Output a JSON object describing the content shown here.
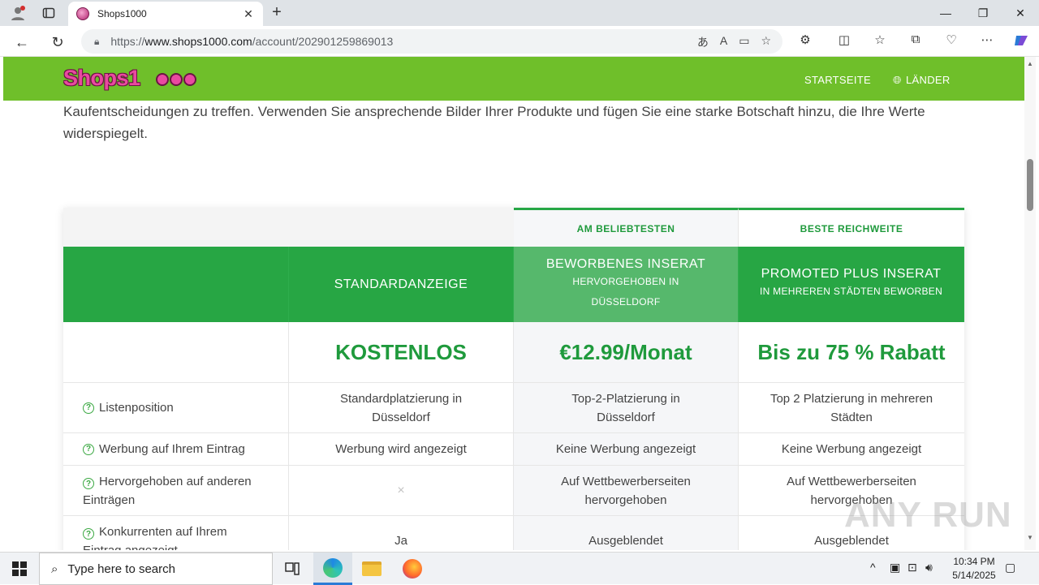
{
  "browser": {
    "tab_title": "Shops1000",
    "url_prefix": "https://",
    "url_host": "www.shops1000.com",
    "url_path": "/account/202901259869013"
  },
  "site": {
    "logo_text": "Shops1",
    "nav": [
      "STARTSEITE",
      "LÄNDER"
    ]
  },
  "intro_text": "Kaufentscheidungen zu treffen. Verwenden Sie ansprechende Bilder Ihrer Produkte und fügen Sie eine starke Botschaft hinzu, die Ihre Werte widerspiegelt.",
  "pricing": {
    "badges": [
      "AM BELIEBTESTEN",
      "BESTE REICHWEITE"
    ],
    "plans": [
      {
        "title": "STANDARDANZEIGE",
        "subtitle": "",
        "price": "KOSTENLOS"
      },
      {
        "title": "BEWORBENES INSERAT",
        "subtitle": "HERVORGEHOBEN IN DÜSSELDORF",
        "price": "€12.99/Monat"
      },
      {
        "title": "PROMOTED PLUS INSERAT",
        "subtitle": "IN MEHREREN STÄDTEN BEWORBEN",
        "price": "Bis zu 75 % Rabatt"
      }
    ],
    "features": [
      {
        "label": "Listenposition",
        "values": [
          "Standardplatzierung in Düsseldorf",
          "Top-2-Platzierung in Düsseldorf",
          "Top 2 Platzierung in mehreren Städten"
        ]
      },
      {
        "label": "Werbung auf Ihrem Eintrag",
        "values": [
          "Werbung wird angezeigt",
          "Keine Werbung angezeigt",
          "Keine Werbung angezeigt"
        ]
      },
      {
        "label": "Hervorgehoben auf anderen Einträgen",
        "values": [
          "×",
          "Auf Wettbewerberseiten hervorgehoben",
          "Auf Wettbewerberseiten hervorgehoben"
        ]
      },
      {
        "label": "Konkurrenten auf Ihrem Eintrag angezeigt",
        "values": [
          "Ja",
          "Ausgeblendet",
          "Ausgeblendet"
        ]
      }
    ]
  },
  "taskbar": {
    "search_placeholder": "Type here to search",
    "time": "10:34 PM",
    "date": "5/14/2025"
  },
  "watermark": "ANY RUN"
}
